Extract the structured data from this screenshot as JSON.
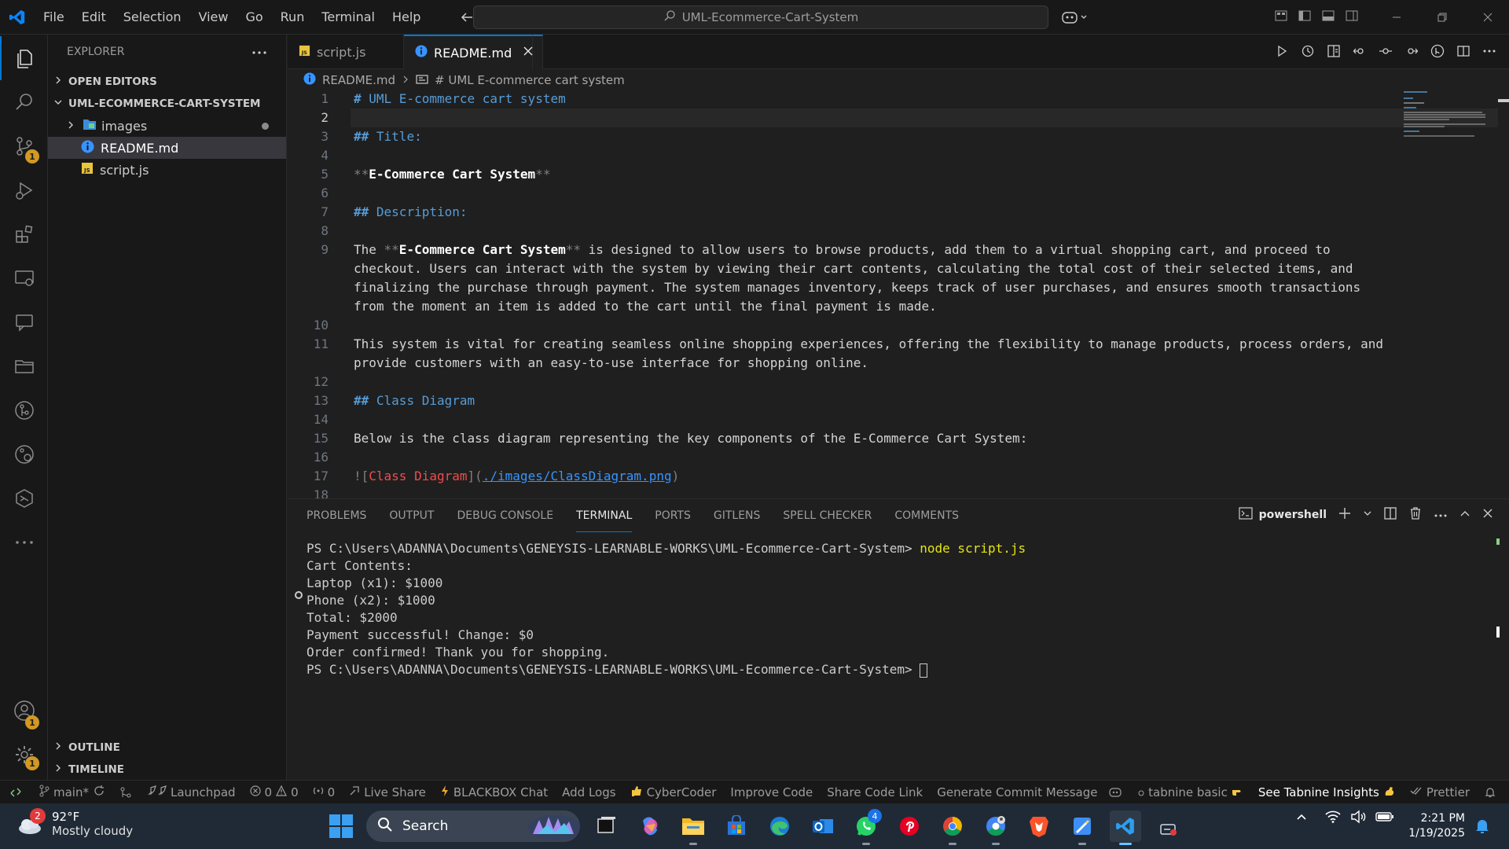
{
  "menu": [
    "File",
    "Edit",
    "Selection",
    "View",
    "Go",
    "Run",
    "Terminal",
    "Help"
  ],
  "search": {
    "label": "UML-Ecommerce-Cart-System"
  },
  "sidebar": {
    "title": "EXPLORER",
    "open_editors": "OPEN EDITORS",
    "folder": "UML-ECOMMERCE-CART-SYSTEM",
    "items": [
      {
        "label": "images",
        "type": "folder"
      },
      {
        "label": "README.md",
        "type": "readme"
      },
      {
        "label": "script.js",
        "type": "js"
      }
    ],
    "outline": "OUTLINE",
    "timeline": "TIMELINE"
  },
  "activity_badges": {
    "scm": "1",
    "accounts": "1",
    "settings": "1"
  },
  "tabs": [
    {
      "label": "script.js",
      "active": false
    },
    {
      "label": "README.md",
      "active": true
    }
  ],
  "breadcrumb": {
    "file": "README.md",
    "symbol": "# UML E-commerce cart system"
  },
  "editor": {
    "l1": "UML E-commerce cart system",
    "l3": "Title:",
    "l5": "E-Commerce Cart System",
    "l7": "Description:",
    "l9_a": "The ",
    "l9_b": "E-Commerce Cart System",
    "l9_c": " is designed to allow users to browse products, add them to a virtual shopping cart, and proceed to",
    "l9_2": "checkout. Users can interact with the system by viewing their cart contents, calculating the total cost of their selected items, and",
    "l9_3": "finalizing the purchase through payment. The system manages inventory, keeps track of user purchases, and ensures smooth transactions",
    "l9_4": "from the moment an item is added to the cart until the final payment is made.",
    "l11_1": "This system is vital for creating seamless online shopping experiences, offering the flexibility to manage products, process orders, and",
    "l11_2": "provide customers with an easy-to-use interface for shopping online.",
    "l13": "Class Diagram",
    "l15": "Below is the class diagram representing the key components of the E-Commerce Cart System:",
    "l17_text": "Class Diagram",
    "l17_url": "./images/ClassDiagram.png"
  },
  "panel": {
    "tabs": [
      "PROBLEMS",
      "OUTPUT",
      "DEBUG CONSOLE",
      "TERMINAL",
      "PORTS",
      "GITLENS",
      "SPELL CHECKER",
      "COMMENTS"
    ],
    "shell": "powershell"
  },
  "terminal": {
    "prompt": "PS C:\\Users\\ADANNA\\Documents\\GENEYSIS-LEARNABLE-WORKS\\UML-Ecommerce-Cart-System>",
    "command": " node script.js",
    "out1": "Cart Contents:",
    "out2": "Laptop (x1): $1000",
    "out3": "Phone (x2): $1000",
    "out4": "Total: $2000",
    "out5": "Payment successful! Change: $0",
    "out6": "Order confirmed! Thank you for shopping."
  },
  "status": {
    "branch": "main*",
    "launchpad": "Launchpad",
    "errors": "0",
    "warnings": "0",
    "ports": "0",
    "liveshare": "Live Share",
    "blackbox": "BLACKBOX Chat",
    "addlogs": "Add Logs",
    "cybercoder": "CyberCoder",
    "improve": "Improve Code",
    "sharelink": "Share Code Link",
    "commit": "Generate Commit Message",
    "tabnine": "tabnine basic",
    "insights": "See Tabnine Insights",
    "prettier": "Prettier"
  },
  "taskbar": {
    "weather_badge": "2",
    "temp": "92°F",
    "condition": "Mostly cloudy",
    "search": "Search",
    "whatsapp_badge": "4",
    "time": "2:21 PM",
    "date": "1/19/2025"
  },
  "colors": {
    "accent": "#0078d4",
    "heading": "#569cd6",
    "badge": "#d29922"
  }
}
